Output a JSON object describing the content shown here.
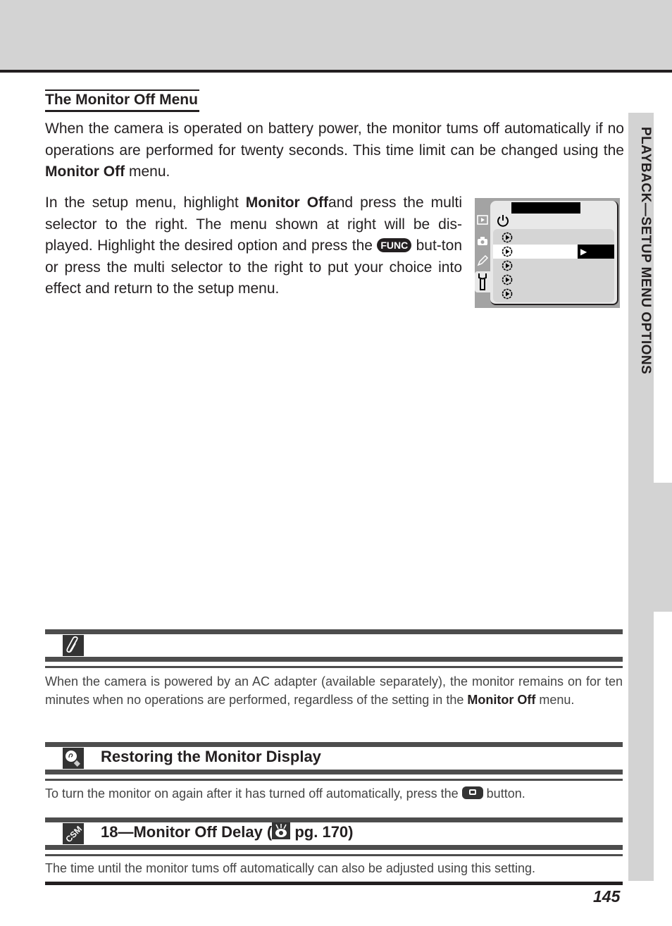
{
  "header": {
    "band_color": "#d3d3d3",
    "rule_color": "#231f20"
  },
  "side_tab": {
    "label": "PLAYBACK—SETUP MENU OPTIONS",
    "color": "#d3d3d3"
  },
  "section": {
    "title": "The Monitor Off Menu",
    "paragraph1": {
      "before": "When the camera is operated on battery power, the monitor tums off automatically if no operations are performed for twenty seconds. This time limit can be changed using the ",
      "bold": "Monitor Off",
      "after": " menu."
    },
    "paragraph2": {
      "before": "In the setup menu, highlight ",
      "bold": "Monitor Off",
      "middle": "and press the multi selector to the right. The menu shown at right will be dis-played.  Highlight the desired option and press the ",
      "button_label": "FUNC",
      "after": " but-ton or press the multi selector to the right to put your choice into effect and return to the setup menu."
    }
  },
  "camera_menu": {
    "side_icons": [
      "playback-icon",
      "camera-icon",
      "pencil-icon",
      "wrench-icon"
    ],
    "title_icon": "power-icon",
    "rows": [
      {
        "icon": "self-timer-icon",
        "selected": false
      },
      {
        "icon": "self-timer-icon",
        "selected": true,
        "indicator": "▶"
      },
      {
        "icon": "self-timer-icon",
        "selected": false
      },
      {
        "icon": "self-timer-icon",
        "selected": false
      },
      {
        "icon": "self-timer-icon",
        "selected": false
      }
    ]
  },
  "notes": [
    {
      "icon": "paperclip-icon",
      "heading": "",
      "text_before": "When the camera is powered by an AC adapter (available separately), the monitor remains on for ten minutes when no operations are performed, regardless of the setting in the ",
      "text_bold": "Monitor Off",
      "text_after": " menu."
    },
    {
      "icon": "lightbulb-tip-icon",
      "heading": "Restoring the Monitor Display",
      "text_before": "To turn the monitor on again after it has turned off automatically, press the ",
      "button": "monitor-button",
      "text_after": " button."
    },
    {
      "icon": "csm-icon",
      "heading_before": "18—Monitor Off Delay (",
      "heading_ref_icon": "eye-reference-icon",
      "heading_after": " pg. 170)",
      "text": "The time until the monitor tums off automatically can also be adjusted using this setting."
    }
  ],
  "page_number": "145"
}
